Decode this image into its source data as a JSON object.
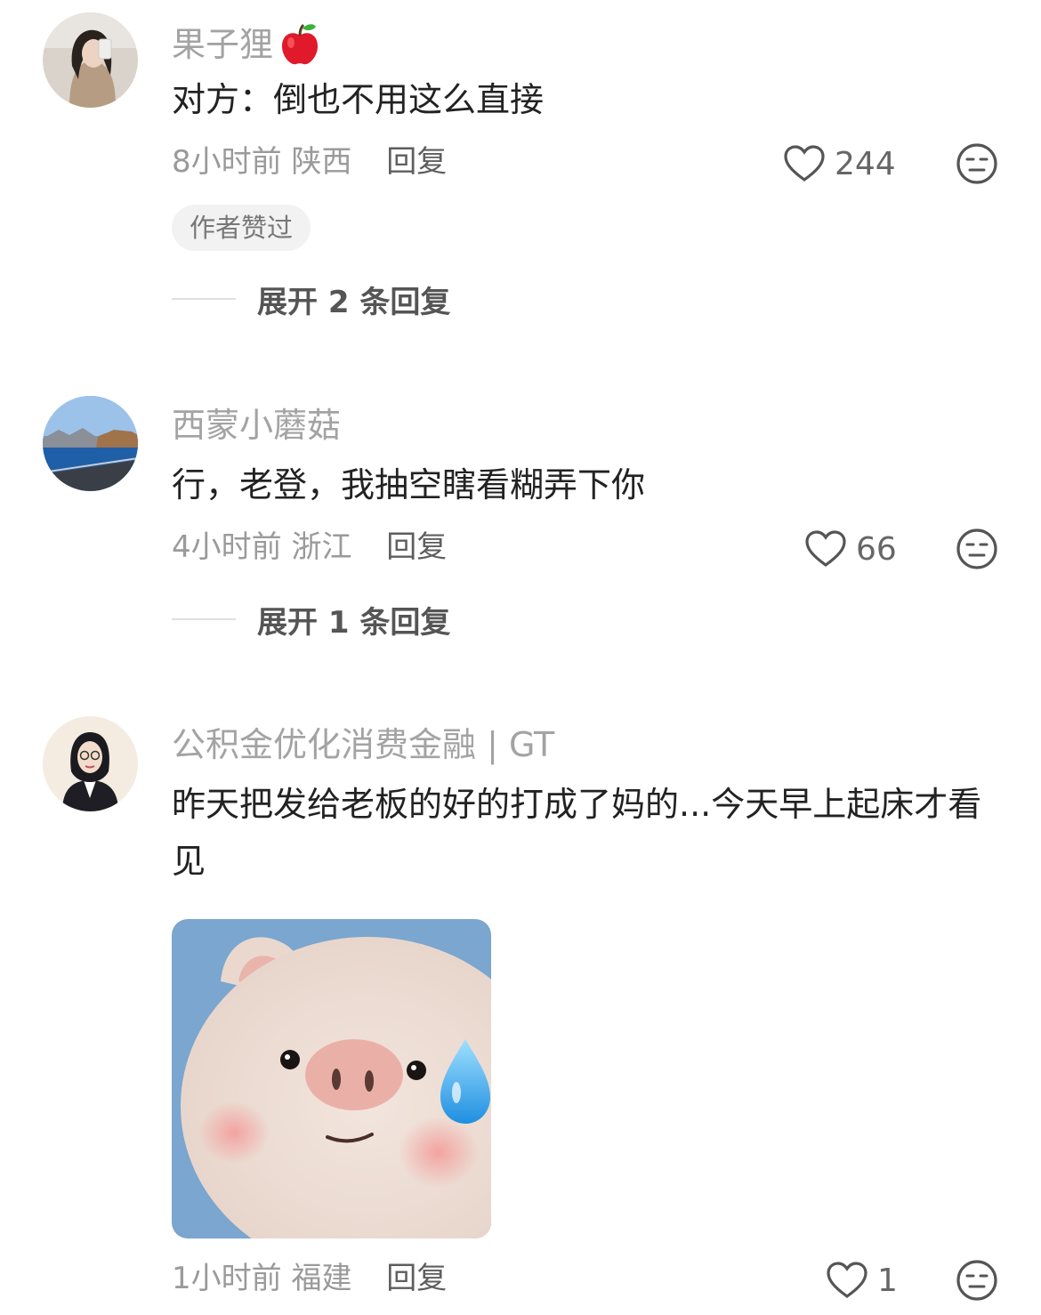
{
  "comments": [
    {
      "username": "果子狸",
      "badge_icon": "apple-emoji",
      "text": "对方：倒也不用这么直接",
      "time": "8小时前",
      "location": "陕西",
      "reply_label": "回复",
      "likes": "244",
      "author_liked": "作者赞过",
      "expand_label": "展开 2 条回复"
    },
    {
      "username": "西蒙小蘑菇",
      "text": "行，老登，我抽空瞎看糊弄下你",
      "time": "4小时前",
      "location": "浙江",
      "reply_label": "回复",
      "likes": "66",
      "expand_label": "展开 1 条回复"
    },
    {
      "username": "公积金优化消费金融 | GT",
      "text": "昨天把发给老板的好的打成了妈的...今天早上起床才看见",
      "image": "felt-pig-sweat-meme",
      "time": "1小时前",
      "location": "福建",
      "reply_label": "回复",
      "likes": "1"
    }
  ],
  "icons": {
    "like": "heart-outline-icon",
    "dislike": "meh-face-icon"
  }
}
